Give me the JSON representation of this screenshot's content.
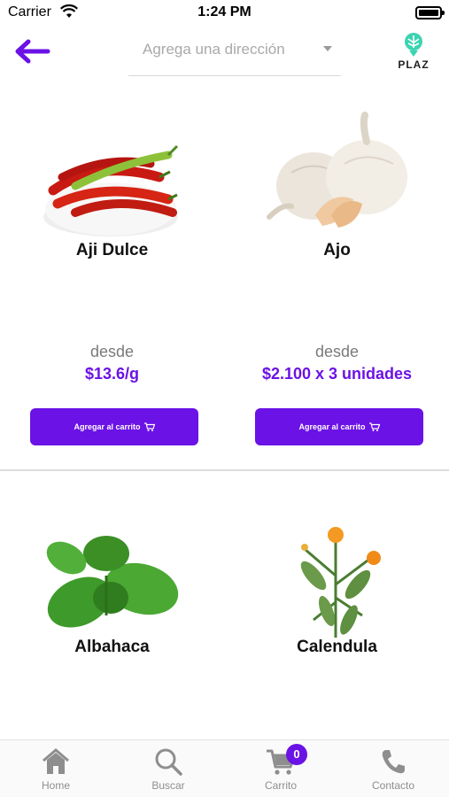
{
  "status_bar": {
    "carrier": "Carrier",
    "time": "1:24 PM"
  },
  "header": {
    "address_placeholder": "Agrega una dirección",
    "logo_text": "PLAZ"
  },
  "products": [
    {
      "name": "Aji Dulce",
      "from_label": "desde",
      "price": "$13.6/g",
      "button_label": "Agregar al carrito"
    },
    {
      "name": "Ajo",
      "from_label": "desde",
      "price": "$2.100 x 3 unidades",
      "button_label": "Agregar al carrito"
    },
    {
      "name": "Albahaca"
    },
    {
      "name": "Calendula"
    }
  ],
  "tabbar": {
    "items": [
      {
        "label": "Home",
        "icon": "home-icon"
      },
      {
        "label": "Buscar",
        "icon": "search-icon"
      },
      {
        "label": "Carrito",
        "icon": "cart-icon",
        "badge": "0"
      },
      {
        "label": "Contacto",
        "icon": "phone-icon"
      }
    ]
  },
  "colors": {
    "accent": "#6b12e6",
    "muted": "#8e8e8e"
  }
}
